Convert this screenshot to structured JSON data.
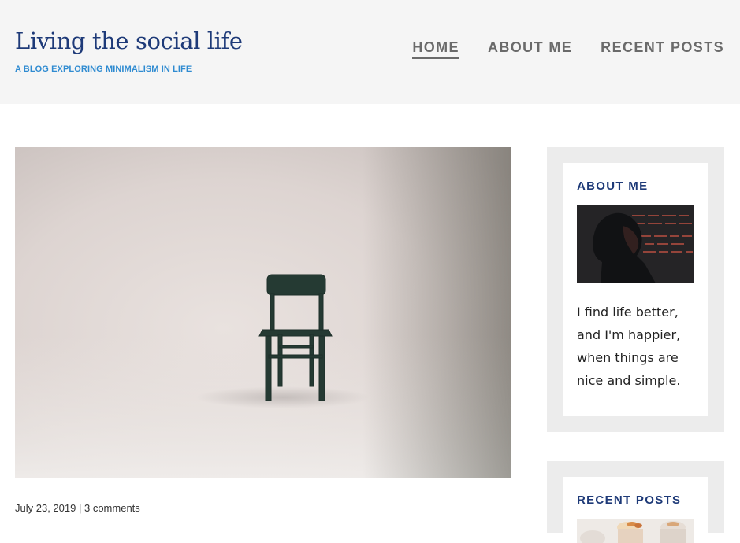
{
  "site": {
    "title": "Living the social life",
    "tagline": "A BLOG EXPLORING MINIMALISM IN LIFE"
  },
  "nav": {
    "items": [
      {
        "label": "HOME",
        "active": true
      },
      {
        "label": "ABOUT ME",
        "active": false
      },
      {
        "label": "RECENT POSTS",
        "active": false
      }
    ]
  },
  "post": {
    "date": "July 23, 2019",
    "separator": "|",
    "comments": "3 comments",
    "image": "chair-photo"
  },
  "sidebar": {
    "about": {
      "title": "ABOUT ME",
      "photo": "portrait-photo",
      "text": "I find life better, and I'm happier, when things are nice and simple."
    },
    "recent": {
      "title": "RECENT POSTS",
      "thumb": "food-photo"
    }
  },
  "colors": {
    "title": "#1e3a78",
    "tagline": "#2f8bd1",
    "nav": "#6a6a6a",
    "header_bg": "#f5f5f5",
    "widget_bg": "#ececec"
  }
}
